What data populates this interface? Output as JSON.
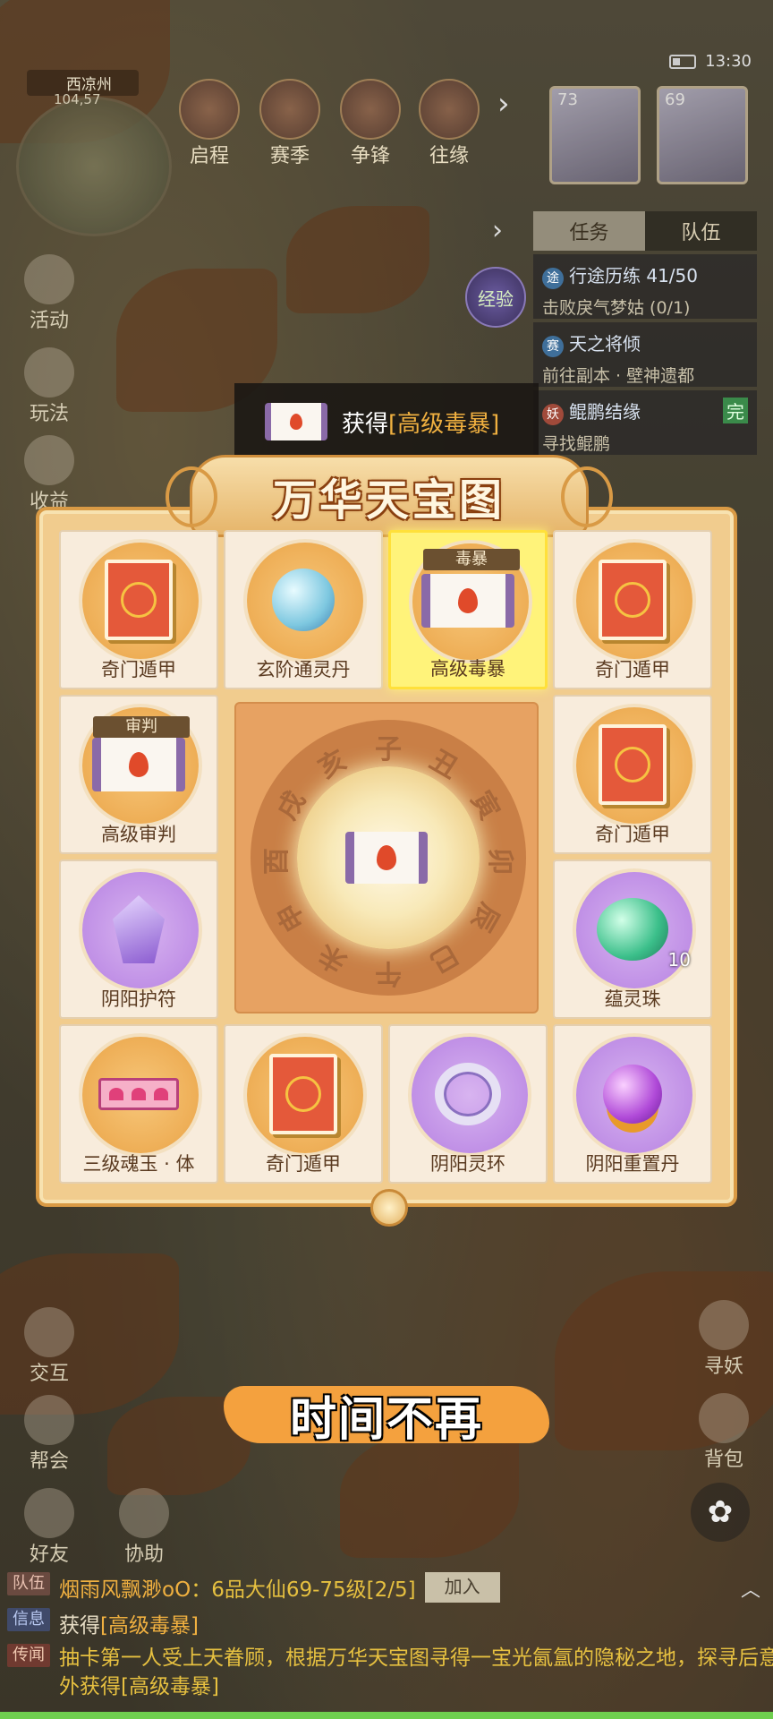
{
  "status": {
    "time": "13:30"
  },
  "map": {
    "location": "西凉州",
    "coords": "104,57"
  },
  "top_menu": [
    {
      "label": "启程"
    },
    {
      "label": "赛季"
    },
    {
      "label": "争锋"
    },
    {
      "label": "往缘"
    }
  ],
  "party": [
    {
      "level": "73"
    },
    {
      "level": "69"
    }
  ],
  "side_menu": [
    {
      "label": "活动"
    },
    {
      "label": "玩法"
    },
    {
      "label": "收益"
    }
  ],
  "task_panel": {
    "tabs": [
      "任务",
      "队伍"
    ],
    "exp_label": "经验",
    "tasks": [
      {
        "badge": "途",
        "title": "行途历练 41/50",
        "desc": "击败戾气梦姑 (0/1)"
      },
      {
        "badge": "赛",
        "title": "天之将倾",
        "desc": "前往副本 · 壁神遗都"
      },
      {
        "badge": "妖",
        "title": "鲲鹏结缘",
        "desc": "寻找鲲鹏",
        "status": "完"
      }
    ]
  },
  "toast": {
    "prefix": "获得",
    "item": "[高级毒暴]"
  },
  "panel": {
    "title": "万华天宝图",
    "cells": [
      {
        "label": "奇门遁甲",
        "icon": "book-icon"
      },
      {
        "label": "玄阶通灵丹",
        "icon": "pearl-icon"
      },
      {
        "label": "高级毒暴",
        "icon": "scroll-icon",
        "tag": "毒暴",
        "selected": true
      },
      {
        "label": "奇门遁甲",
        "icon": "book-icon"
      },
      {
        "label": "高级审判",
        "icon": "scroll-icon",
        "tag": "审判"
      },
      {
        "label": "奇门遁甲",
        "icon": "book-icon"
      },
      {
        "label": "阴阳护符",
        "icon": "amulet-icon"
      },
      {
        "label": "蕴灵珠",
        "icon": "jade-icon",
        "qty": "10"
      },
      {
        "label": "三级魂玉 · 体",
        "icon": "soul-jade-icon"
      },
      {
        "label": "奇门遁甲",
        "icon": "book-icon"
      },
      {
        "label": "阴阳灵环",
        "icon": "ring-icon"
      },
      {
        "label": "阴阳重置丹",
        "icon": "orb-icon"
      }
    ],
    "dial_branches": [
      "子",
      "丑",
      "寅",
      "卯",
      "辰",
      "巳",
      "午",
      "未",
      "申",
      "酉",
      "戌",
      "亥"
    ]
  },
  "left_bottom_menu": [
    {
      "label": "交互"
    },
    {
      "label": "帮会"
    },
    {
      "label": "好友"
    },
    {
      "label": "协助"
    }
  ],
  "right_bottom_menu": [
    {
      "label": "寻妖"
    },
    {
      "label": "背包"
    }
  ],
  "subtitle": "时间不再",
  "chat": {
    "line1": {
      "tag": "队伍",
      "name": "烟雨风飘渺oO",
      "text": "：6品大仙69-75级[2/5]",
      "button": "加入"
    },
    "line2": {
      "tag": "信息",
      "prefix": "获得",
      "item": "[高级毒暴]"
    },
    "line3": {
      "tag": "传闻",
      "text": "抽卡第一人受上天眷顾，根据万华天宝图寻得一宝光氤氲的隐秘之地，探寻后意外获得[高级毒暴]"
    }
  }
}
